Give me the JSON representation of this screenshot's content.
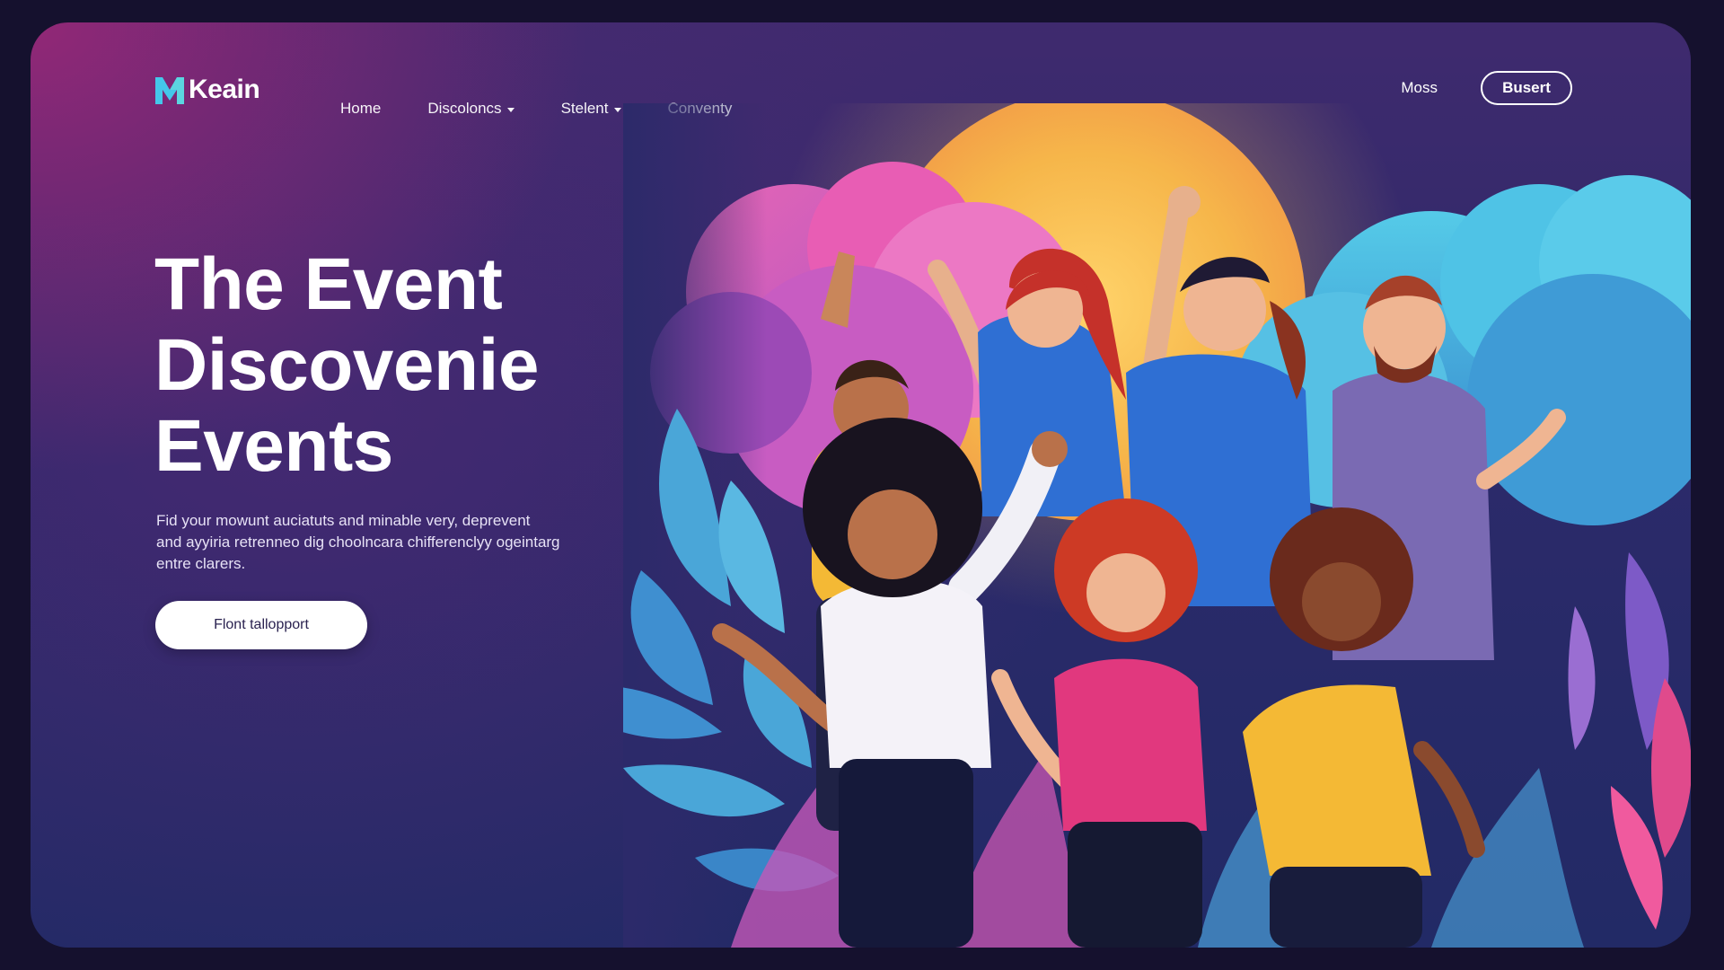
{
  "brand": {
    "name": "Keain",
    "logo_icon": "m-logo-icon",
    "accent": "#44c8ea"
  },
  "nav": {
    "links": [
      {
        "label": "Home",
        "has_dropdown": false
      },
      {
        "label": "Discoloncs",
        "has_dropdown": true
      },
      {
        "label": "Stelent",
        "has_dropdown": true
      },
      {
        "label": "Conventy",
        "has_dropdown": false
      }
    ],
    "right_link": "Moss",
    "button_label": "Busert"
  },
  "hero": {
    "title_lines": [
      "The Event",
      "Discovenie",
      "Events"
    ],
    "description_lines": [
      "Fid your mowunt auciatuts and minable very, deprevent",
      "and ayyiria retrenneo dig choolncara chifferenclyy ogeintarg",
      "entre clarers."
    ],
    "cta_label": "Flont tallopport"
  },
  "illustration": {
    "subject": "group of cheering people with sun and foliage",
    "colors": {
      "sun": "#f6b64a",
      "cloud_pink": "#e55fb3",
      "cloud_teal": "#4cc4e6",
      "leaf_teal": "#4aa6d8",
      "leaf_pink": "#e04a8c"
    }
  }
}
